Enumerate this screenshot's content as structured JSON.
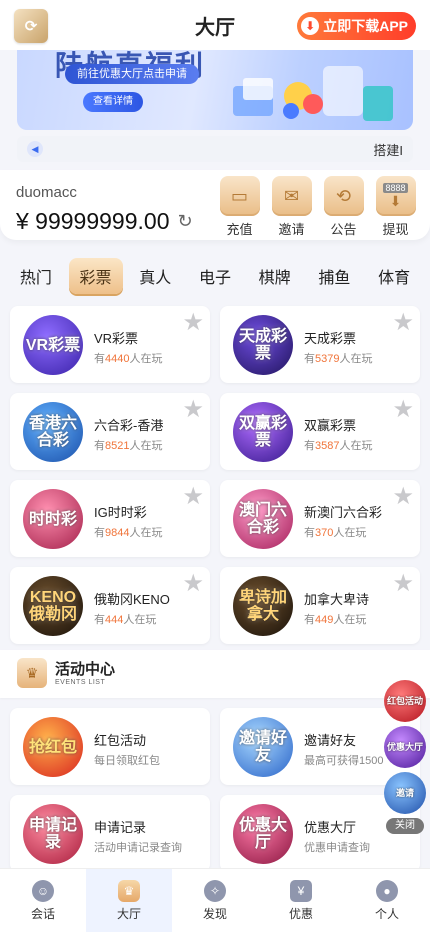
{
  "header": {
    "title": "大厅",
    "download_label": "立即下载APP",
    "logo_icon": "gold-swirl-logo"
  },
  "banner": {
    "headline": "陆航直福利",
    "subtitle": "前往优惠大厅点击申请",
    "button": "查看详情"
  },
  "marquee": {
    "text": "搭建I"
  },
  "account": {
    "username": "duomacc",
    "balance": "¥ 99999999.00",
    "actions": [
      {
        "label": "充值",
        "icon": "wallet-icon"
      },
      {
        "label": "邀请",
        "icon": "envelope-icon"
      },
      {
        "label": "公告",
        "icon": "announcement-icon"
      },
      {
        "label": "提现",
        "icon": "withdraw-icon",
        "badge": "8888"
      }
    ]
  },
  "tabs": [
    {
      "label": "热门",
      "active": false
    },
    {
      "label": "彩票",
      "active": true
    },
    {
      "label": "真人",
      "active": false
    },
    {
      "label": "电子",
      "active": false
    },
    {
      "label": "棋牌",
      "active": false
    },
    {
      "label": "捕鱼",
      "active": false
    },
    {
      "label": "体育",
      "active": false
    }
  ],
  "games": [
    {
      "name": "VR彩票",
      "prefix": "有",
      "count": "4440",
      "suffix": "人在玩",
      "thumb_text": "VR彩票",
      "thumb_color": "#5a3fd6"
    },
    {
      "name": "天成彩票",
      "prefix": "有",
      "count": "5379",
      "suffix": "人在玩",
      "thumb_text": "天成彩票",
      "thumb_color": "#3b2a8f"
    },
    {
      "name": "六合彩-香港",
      "prefix": "有",
      "count": "8521",
      "suffix": "人在玩",
      "thumb_text": "香港六合彩",
      "thumb_color": "#2a74d6"
    },
    {
      "name": "双赢彩票",
      "prefix": "有",
      "count": "3587",
      "suffix": "人在玩",
      "thumb_text": "双赢彩票",
      "thumb_color": "#5b2fc8"
    },
    {
      "name": "IG时时彩",
      "prefix": "有",
      "count": "9844",
      "suffix": "人在玩",
      "thumb_text": "时时彩",
      "thumb_color": "#d23a6a"
    },
    {
      "name": "新澳门六合彩",
      "prefix": "有",
      "count": "370",
      "suffix": "人在玩",
      "thumb_text": "澳门六合彩",
      "thumb_color": "#d83a7a"
    },
    {
      "name": "俄勒冈KENO",
      "prefix": "有",
      "count": "444",
      "suffix": "人在玩",
      "thumb_text": "KENO俄勒冈",
      "thumb_color": "#3a2a1a"
    },
    {
      "name": "加拿大卑诗",
      "prefix": "有",
      "count": "449",
      "suffix": "人在玩",
      "thumb_text": "卑诗加拿大",
      "thumb_color": "#3a2a1a"
    }
  ],
  "activity": {
    "title": "活动中心",
    "subtitle": "EVENTS LIST"
  },
  "promos": [
    {
      "name": "红包活动",
      "desc": "每日领取红包",
      "thumb_text": "抢红包",
      "thumb_color": "#e2332c"
    },
    {
      "name": "邀请好友",
      "desc": "最高可获得1500",
      "thumb_text": "邀请好友",
      "thumb_color": "#2f78d8"
    },
    {
      "name": "申请记录",
      "desc": "活动申请记录查询",
      "thumb_text": "申请记录",
      "thumb_color": "#c9304e"
    },
    {
      "name": "优惠大厅",
      "desc": "优惠申请查询",
      "thumb_text": "优惠大厅",
      "thumb_color": "#c92d58"
    }
  ],
  "floats": {
    "items": [
      {
        "text": "红包活动",
        "color": "#e0323b"
      },
      {
        "text": "优惠大厅",
        "color": "#7a2fc9"
      },
      {
        "text": "邀请",
        "color": "#2f78d8"
      }
    ],
    "close_label": "关闭"
  },
  "bottom_nav": [
    {
      "label": "会话",
      "icon": "chat-icon",
      "active": false
    },
    {
      "label": "大厅",
      "icon": "lobby-icon",
      "active": true
    },
    {
      "label": "发现",
      "icon": "compass-icon",
      "active": false
    },
    {
      "label": "优惠",
      "icon": "yen-icon",
      "active": false
    },
    {
      "label": "个人",
      "icon": "user-icon",
      "active": false
    }
  ]
}
